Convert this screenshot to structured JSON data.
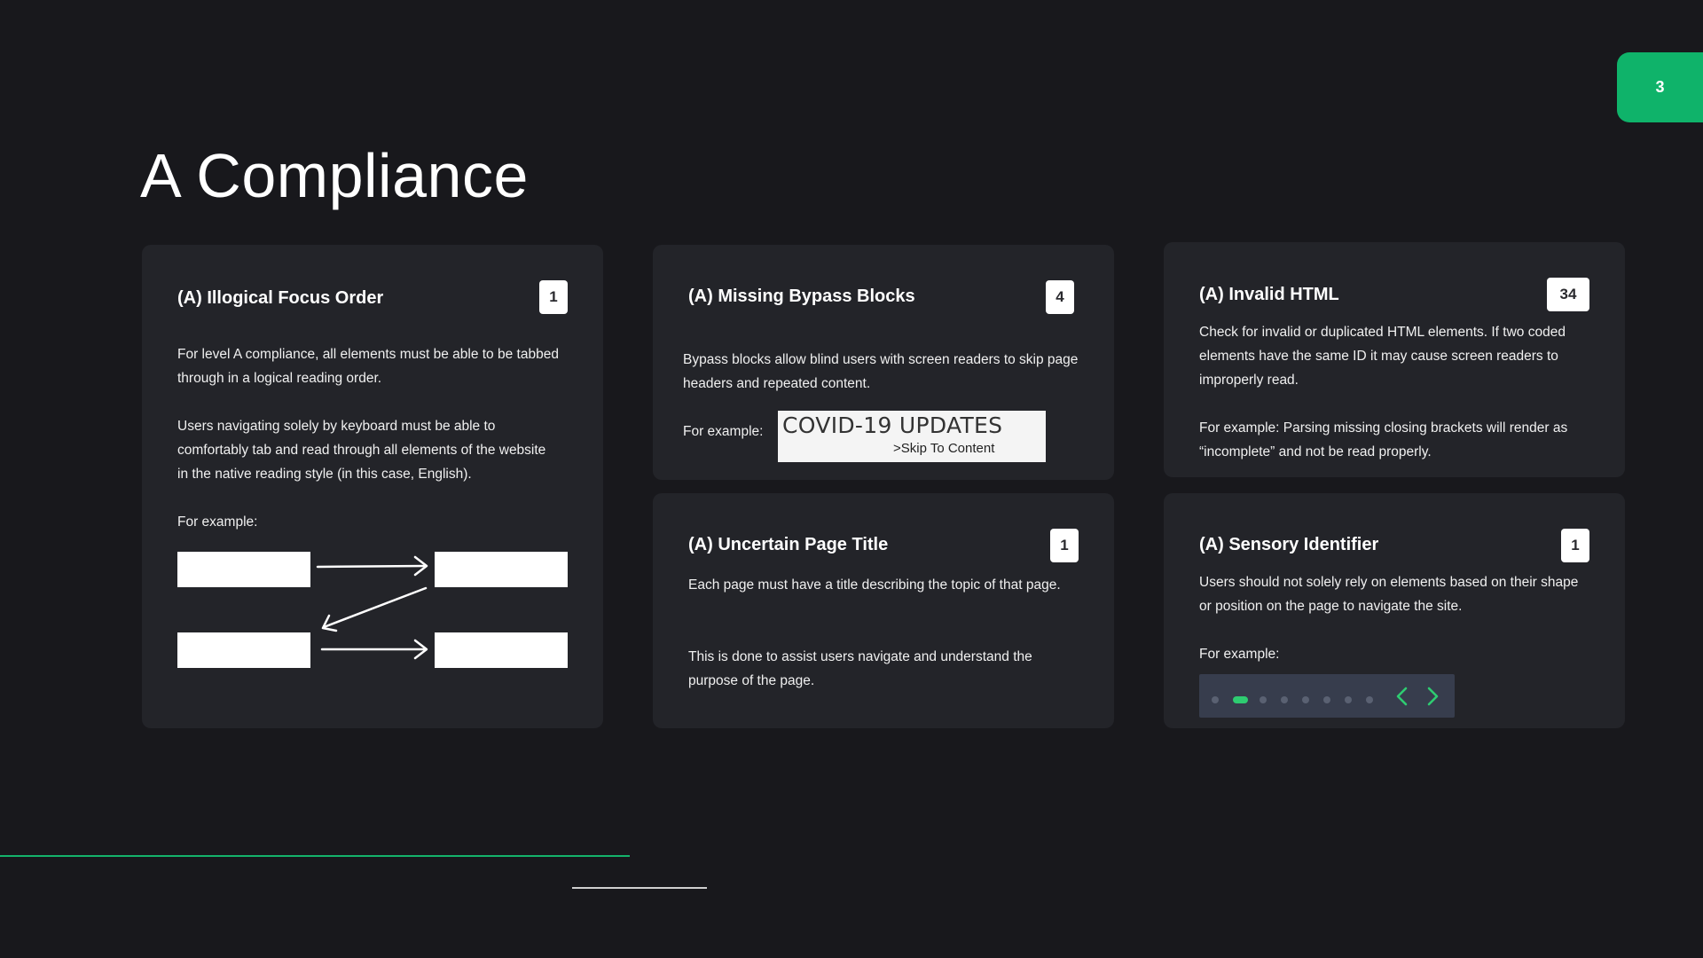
{
  "page_number": "3",
  "page_title": "A Compliance",
  "accent_color": "#0fb36a",
  "cards": {
    "focus_order": {
      "title": "(A) Illogical Focus Order",
      "count": "1",
      "para1": "For level A compliance, all elements must be able to be tabbed through in a logical reading order.",
      "para2": "Users navigating solely by keyboard must be able to comfortably tab and read through all elements of the website in the native reading style (in this case, English).",
      "example_label": "For example:"
    },
    "bypass_blocks": {
      "title": "(A) Missing Bypass Blocks",
      "count": "4",
      "para1": "Bypass blocks allow blind users with screen readers to skip page headers and repeated content.",
      "example_label": "For example:",
      "example_heading": "COVID-19 UPDATES",
      "example_link": ">Skip To Content"
    },
    "invalid_html": {
      "title": "(A) Invalid HTML",
      "count": "34",
      "para1": "Check for invalid or duplicated HTML elements. If two coded elements have the same ID it may cause screen readers to improperly read.",
      "para2": "For example: Parsing missing closing brackets will render as “incomplete” and not be read properly."
    },
    "page_title": {
      "title": "(A) Uncertain Page Title",
      "count": "1",
      "para1": "Each page must have a title describing the topic of that page.",
      "para2": "This is done to assist users navigate and understand the purpose of the page."
    },
    "sensory": {
      "title": "(A) Sensory Identifier",
      "count": "1",
      "para1": "Users should not solely rely on elements based on their shape or position on the page to navigate the site.",
      "example_label": "For example:",
      "carousel_dot_count": 8,
      "carousel_active_index": 1,
      "carousel_icons": [
        "chevron-left-icon",
        "chevron-right-icon"
      ]
    }
  }
}
